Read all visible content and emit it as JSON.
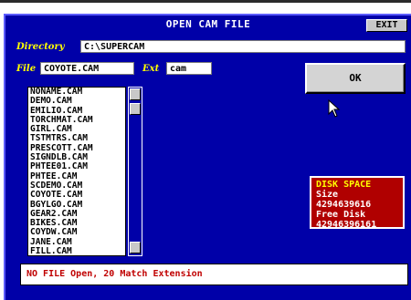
{
  "window": {
    "title": "OPEN CAM FILE",
    "exit_label": "EXIT"
  },
  "directory": {
    "label": "Directory",
    "value": "C:\\SUPERCAM"
  },
  "file": {
    "label": "File",
    "value": "COYOTE.CAM"
  },
  "extension": {
    "label": "Ext",
    "value": "cam"
  },
  "ok_label": "OK",
  "file_list": [
    "NONAME.CAM",
    "DEMO.CAM",
    "EMILIO.CAM",
    "TORCHMAT.CAM",
    "GIRL.CAM",
    "TSTMTRS.CAM",
    "PRESCOTT.CAM",
    "SIGNDLB.CAM",
    "PHTEE01.CAM",
    "PHTEE.CAM",
    "SCDEMO.CAM",
    "COYOTE.CAM",
    "BGYLGO.CAM",
    "GEAR2.CAM",
    "BIKES.CAM",
    "COYDW.CAM",
    "JANE.CAM",
    "FILL.CAM"
  ],
  "disk_space": {
    "title": "DISK SPACE",
    "size_label": "Size",
    "size_value": "4294639616",
    "free_label": "Free Disk",
    "free_value": "42946396161"
  },
  "status": "NO FILE Open, 20 Match Extension",
  "colors": {
    "dialog_bg": "#0000a8",
    "label_yellow": "#ffff00",
    "disk_panel": "#b00000",
    "status_text": "#c00000"
  }
}
